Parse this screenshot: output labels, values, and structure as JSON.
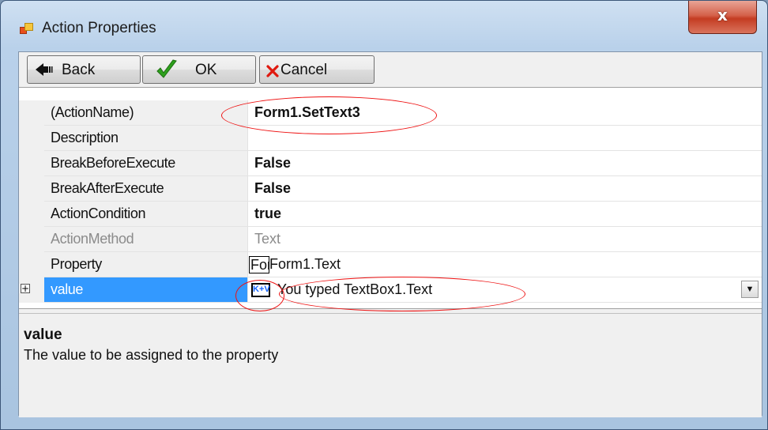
{
  "window": {
    "title": "Action Properties",
    "close_glyph": "x",
    "icon": "app-window-icon"
  },
  "toolbar": {
    "back_label": "Back",
    "ok_label": "OK",
    "cancel_label": "Cancel",
    "back_icon": "back-arrow-icon",
    "ok_icon": "checkmark-icon",
    "cancel_icon": "red-x-icon"
  },
  "grid": {
    "rows": [
      {
        "name": "(ActionName)",
        "value": "Form1.SetText3"
      },
      {
        "name": "Description",
        "value": ""
      },
      {
        "name": "BreakBeforeExecute",
        "value": "False"
      },
      {
        "name": "BreakAfterExecute",
        "value": "False"
      },
      {
        "name": "ActionCondition",
        "value": "true"
      },
      {
        "name": "ActionMethod",
        "value": "Text"
      },
      {
        "name": "Property",
        "value_icon_text": "Form",
        "value": "Form1.Text"
      },
      {
        "name": "value",
        "value_icon_text": "K+V",
        "value": "You typed TextBox1.Text",
        "expander": "+"
      }
    ]
  },
  "help": {
    "title": "value",
    "description": "The value to be assigned to the property"
  },
  "colors": {
    "selection": "#3399ff",
    "annotation": "#ee1111"
  }
}
